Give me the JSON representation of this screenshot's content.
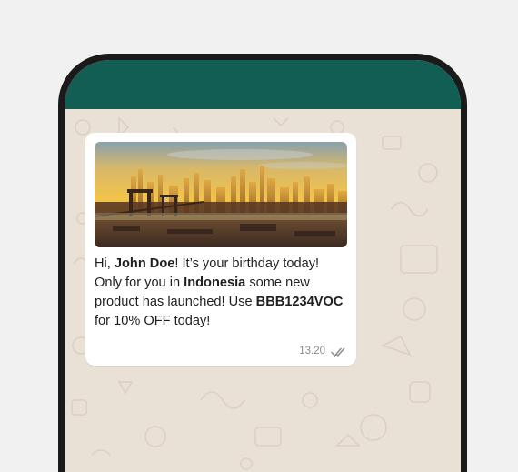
{
  "chat": {
    "header_color": "#125e55",
    "background_color": "#e9e1d6"
  },
  "message": {
    "image": {
      "icon": "city-skyline-sunset-image"
    },
    "text": {
      "part1": "Hi, ",
      "name": "John Doe",
      "part2": "! It’s your birthday today! Only for you in ",
      "country": "Indonesia",
      "part3": " some new product has launched! Use ",
      "code": "BBB1234VOC",
      "part4": " for 10% OFF today!"
    },
    "time": "13.20",
    "status_icon": "double-check-icon"
  }
}
